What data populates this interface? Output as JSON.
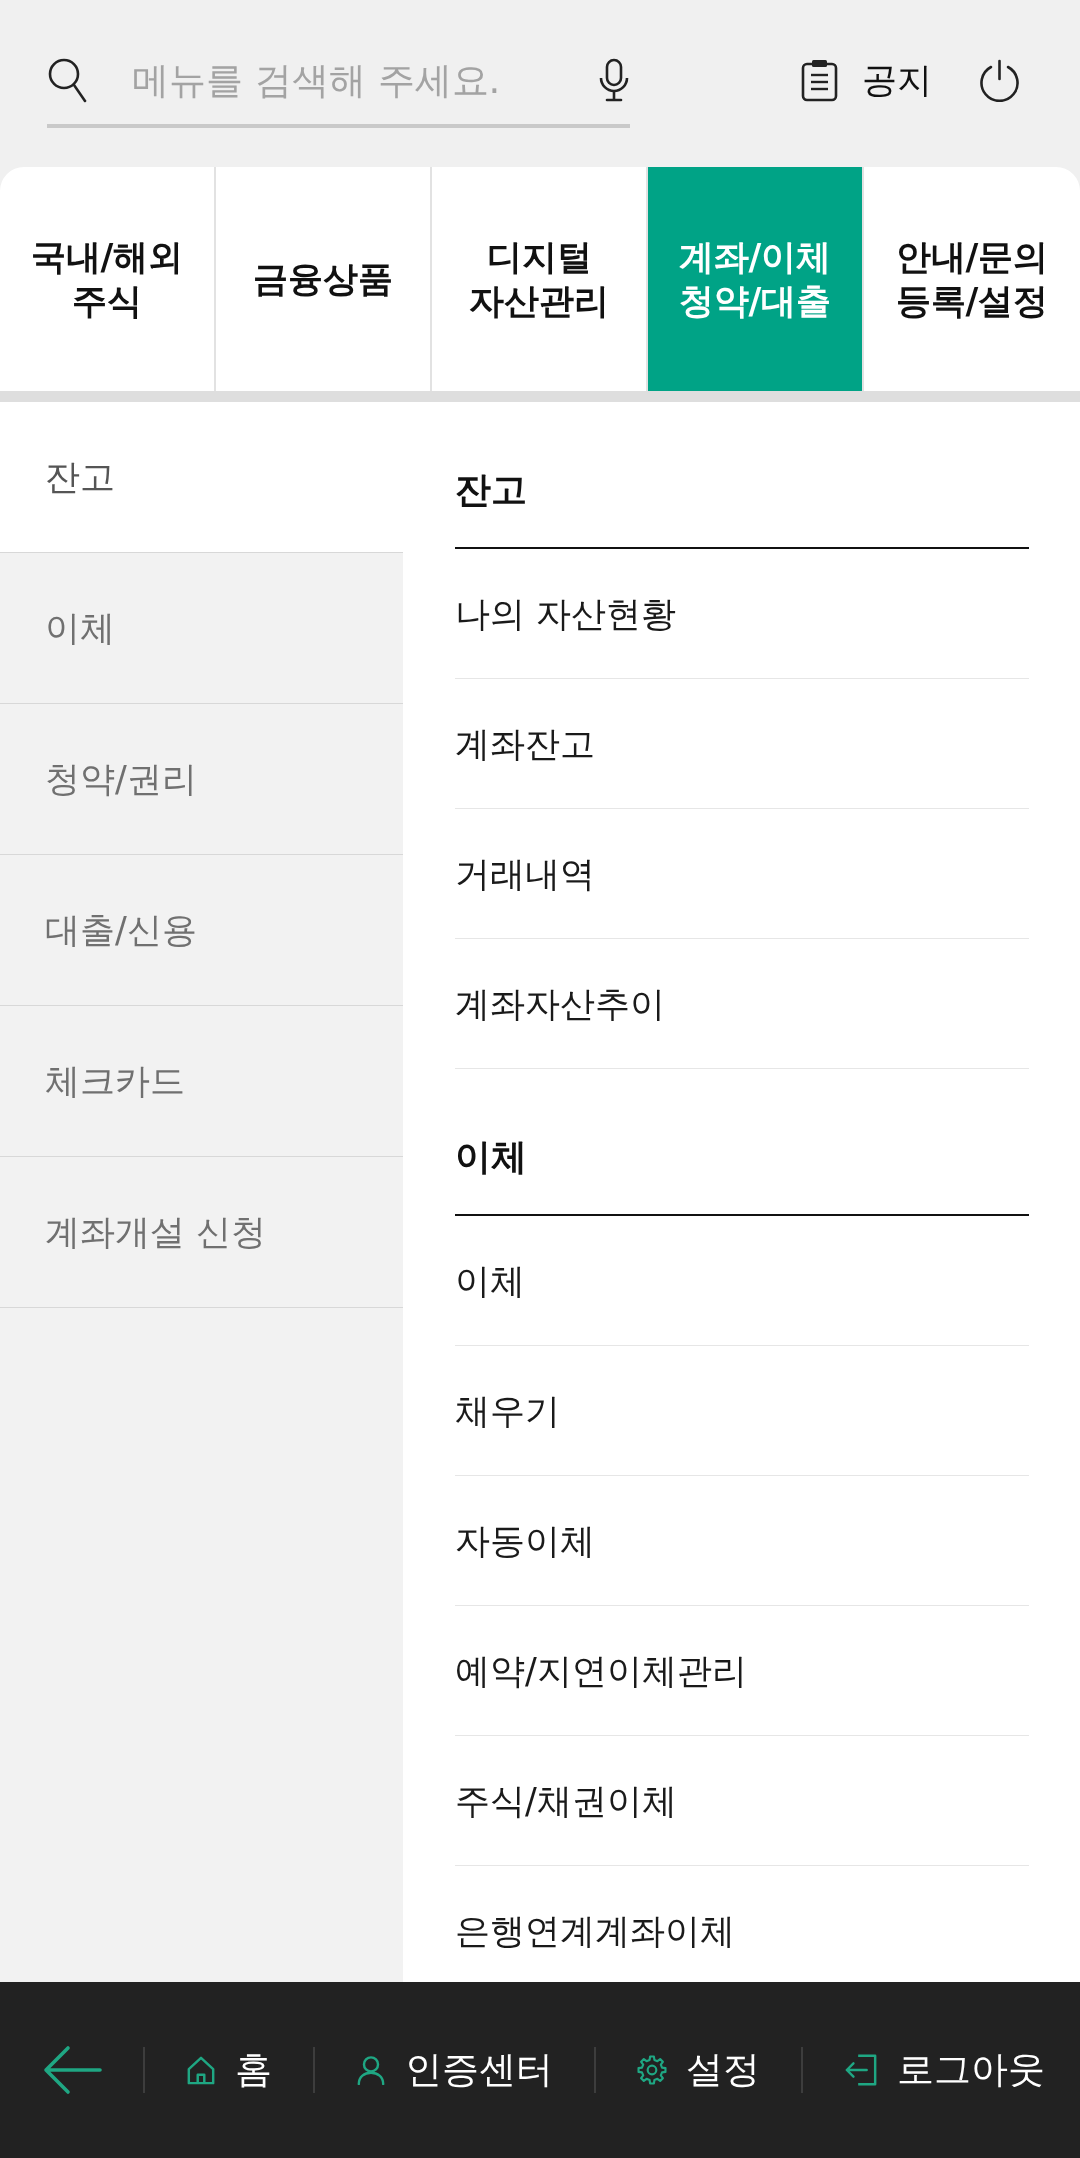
{
  "top_bar": {
    "search": {
      "placeholder": "메뉴를 검색해 주세요."
    },
    "notice_button": {
      "label": "공지"
    }
  },
  "tabs": [
    {
      "label": "국내/해외\n주식",
      "selected": false
    },
    {
      "label": "금융상품",
      "selected": false
    },
    {
      "label": "디지털\n자산관리",
      "selected": false
    },
    {
      "label": "계좌/이체\n청약/대출",
      "selected": true
    },
    {
      "label": "안내/문의\n등록/설정",
      "selected": false
    }
  ],
  "sidebar": {
    "items": [
      {
        "label": "잔고",
        "selected": true
      },
      {
        "label": "이체",
        "selected": false
      },
      {
        "label": "청약/권리",
        "selected": false
      },
      {
        "label": "대출/신용",
        "selected": false
      },
      {
        "label": "체크카드",
        "selected": false
      },
      {
        "label": "계좌개설 신청",
        "selected": false
      }
    ]
  },
  "sections": [
    {
      "title": "잔고",
      "items": [
        "나의 자산현황",
        "계좌잔고",
        "거래내역",
        "계좌자산추이"
      ]
    },
    {
      "title": "이체",
      "items": [
        "이체",
        "채우기",
        "자동이체",
        "예약/지연이체관리",
        "주식/채권이체",
        "은행연계계좌이체"
      ]
    }
  ],
  "bottom_bar": {
    "items": [
      {
        "kind": "back"
      },
      {
        "kind": "home",
        "label": "홈"
      },
      {
        "kind": "person",
        "label": "인증센터"
      },
      {
        "kind": "settings",
        "label": "설정"
      },
      {
        "kind": "logout",
        "label": "로그아웃"
      }
    ]
  }
}
